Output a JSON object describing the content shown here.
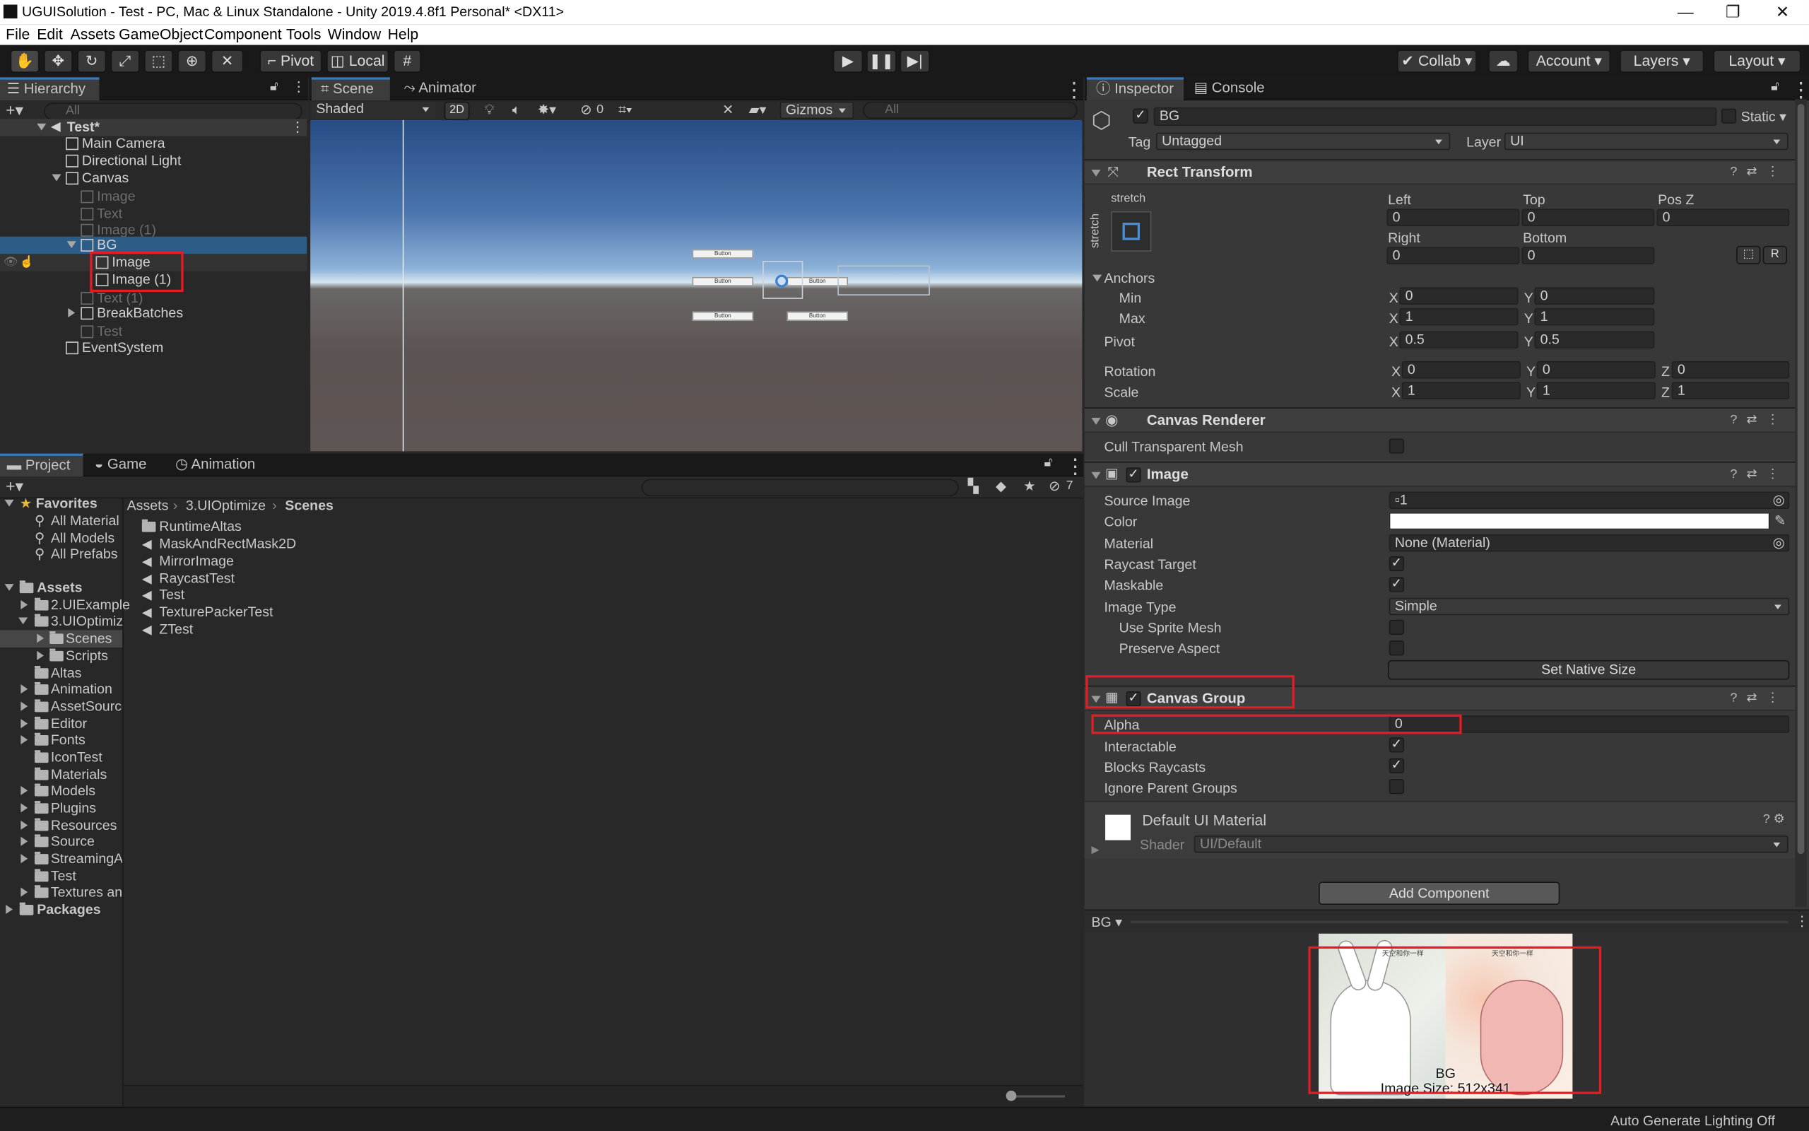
{
  "window": {
    "title": "UGUISolution - Test - PC, Mac & Linux Standalone - Unity 2019.4.8f1 Personal* <DX11>",
    "minimize": "—",
    "maximize": "❐",
    "close": "✕"
  },
  "menu": [
    "File",
    "Edit",
    "Assets",
    "GameObject",
    "Component",
    "Tools",
    "Window",
    "Help"
  ],
  "toolbar": {
    "pivot": "Pivot",
    "local": "Local",
    "collab": "Collab",
    "account": "Account",
    "layers": "Layers",
    "layout": "Layout"
  },
  "hierarchy": {
    "tab": "Hierarchy",
    "search_placeholder": "All",
    "items": [
      {
        "label": "Test*"
      },
      {
        "label": "Main Camera"
      },
      {
        "label": "Directional Light"
      },
      {
        "label": "Canvas"
      },
      {
        "label": "Image"
      },
      {
        "label": "Text"
      },
      {
        "label": "Image (1)"
      },
      {
        "label": "BG"
      },
      {
        "label": "Image"
      },
      {
        "label": "Image (1)"
      },
      {
        "label": "Text (1)"
      },
      {
        "label": "BreakBatches"
      },
      {
        "label": "Test"
      },
      {
        "label": "EventSystem"
      }
    ]
  },
  "scene": {
    "tabs": [
      "Scene",
      "Animator"
    ],
    "shading": "Shaded",
    "mode2d": "2D",
    "hidden_count": "0",
    "gizmos": "Gizmos",
    "search_placeholder": "All",
    "button_labels": [
      "Button",
      "Button",
      "Button",
      "Button",
      "Button"
    ]
  },
  "project": {
    "tabs": [
      "Project",
      "Game",
      "Animation"
    ],
    "hidden_count": "7",
    "breadcrumb": [
      "Assets",
      "3.UIOptimize",
      "Scenes"
    ],
    "favorites": {
      "label": "Favorites",
      "items": [
        "All Material",
        "All Models",
        "All Prefabs"
      ]
    },
    "assets_label": "Assets",
    "tree": [
      "2.UIExample",
      "3.UIOptimiz",
      "Scenes",
      "Scripts",
      "Altas",
      "Animation",
      "AssetSource",
      "Editor",
      "Fonts",
      "IconTest",
      "Materials",
      "Models",
      "Plugins",
      "Resources",
      "Source",
      "StreamingA",
      "Test",
      "Textures an"
    ],
    "packages_label": "Packages",
    "files": [
      "RuntimeAltas",
      "MaskAndRectMask2D",
      "MirrorImage",
      "RaycastTest",
      "Test",
      "TexturePackerTest",
      "ZTest"
    ]
  },
  "inspector": {
    "tabs": [
      "Inspector",
      "Console"
    ],
    "name": "BG",
    "static_label": "Static",
    "tag_label": "Tag",
    "tag_value": "Untagged",
    "layer_label": "Layer",
    "layer_value": "UI",
    "rect": {
      "title": "Rect Transform",
      "stretch": "stretch",
      "left_lbl": "Left",
      "left": "0",
      "top_lbl": "Top",
      "top": "0",
      "posz_lbl": "Pos Z",
      "posz": "0",
      "right_lbl": "Right",
      "right": "0",
      "bottom_lbl": "Bottom",
      "bottom": "0",
      "r_btn": "R",
      "anchors": "Anchors",
      "min": "Min",
      "min_x": "0",
      "min_y": "0",
      "max": "Max",
      "max_x": "1",
      "max_y": "1",
      "pivot": "Pivot",
      "pivot_x": "0.5",
      "pivot_y": "0.5",
      "rotation": "Rotation",
      "rot_x": "0",
      "rot_y": "0",
      "rot_z": "0",
      "scale": "Scale",
      "scale_x": "1",
      "scale_y": "1",
      "scale_z": "1",
      "x": "X",
      "y": "Y",
      "z": "Z"
    },
    "canvas_renderer": {
      "title": "Canvas Renderer",
      "cull": "Cull Transparent Mesh"
    },
    "image": {
      "title": "Image",
      "source_image": "Source Image",
      "source_value": "1",
      "color": "Color",
      "color_value": "#ffffff",
      "material": "Material",
      "material_value": "None (Material)",
      "raycast": "Raycast Target",
      "maskable": "Maskable",
      "image_type": "Image Type",
      "image_type_value": "Simple",
      "use_sprite_mesh": "Use Sprite Mesh",
      "preserve_aspect": "Preserve Aspect",
      "set_native": "Set Native Size"
    },
    "canvas_group": {
      "title": "Canvas Group",
      "alpha": "Alpha",
      "alpha_value": "0",
      "interactable": "Interactable",
      "blocks": "Blocks Raycasts",
      "ignore": "Ignore Parent Groups"
    },
    "material": {
      "name": "Default UI Material",
      "shader_lbl": "Shader",
      "shader": "UI/Default"
    },
    "add_component": "Add Component",
    "preview": {
      "object": "BG",
      "title": "BG",
      "size": "Image Size: 512x341",
      "left_caption": "天空和你一样",
      "right_caption": "天空和你一样"
    }
  },
  "status": {
    "text": "Auto Generate Lighting Off"
  },
  "colors": {
    "accent": "#3a79bb",
    "selection": "#2c5d87",
    "highlight_box": "#e51c23"
  }
}
